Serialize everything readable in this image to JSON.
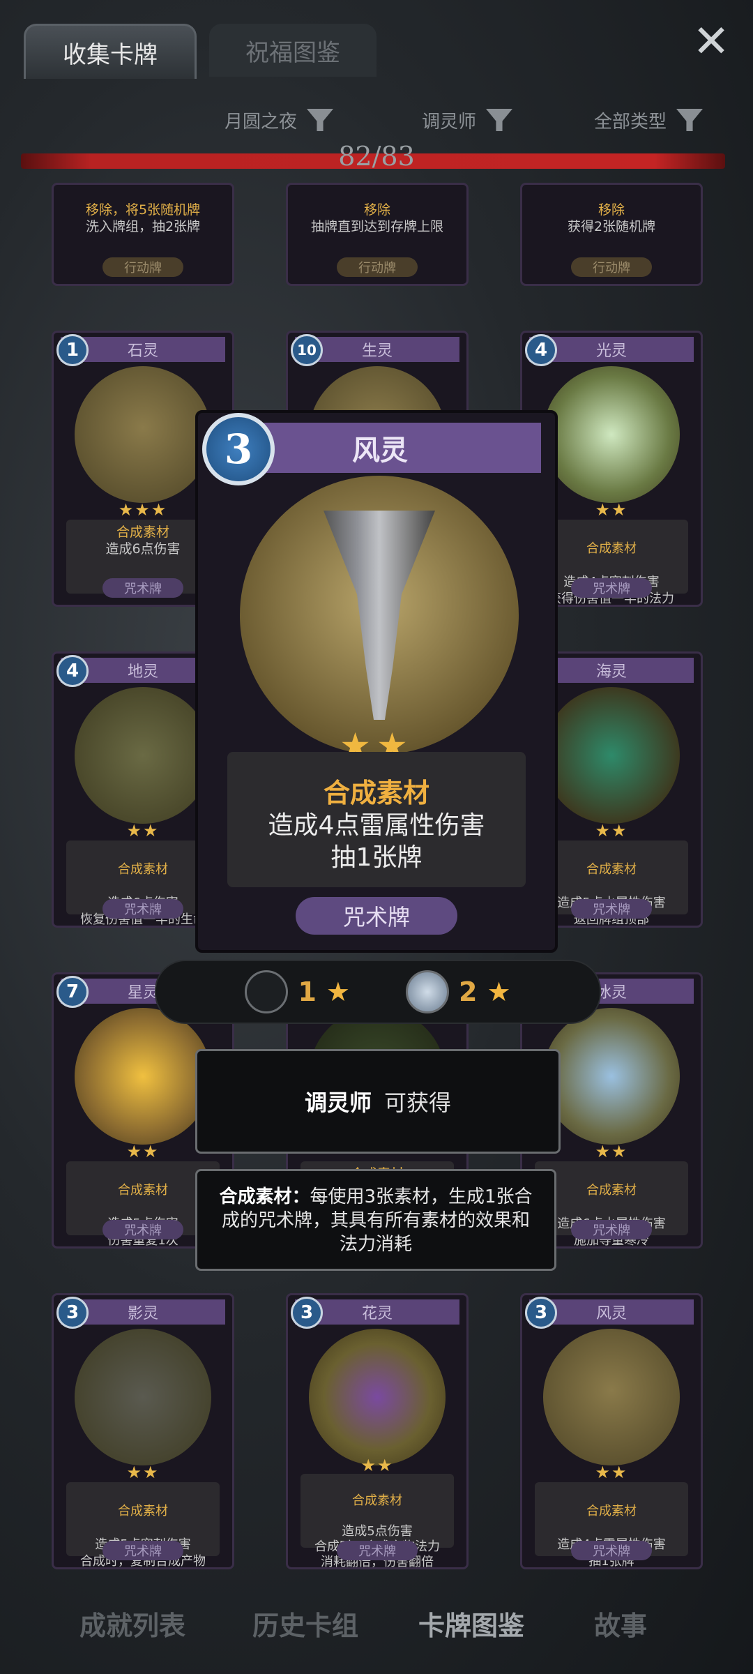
{
  "header": {
    "tabs": [
      {
        "label": "收集卡牌",
        "active": true
      },
      {
        "label": "祝福图鉴",
        "active": false
      }
    ],
    "close_icon": "close-x"
  },
  "filters": [
    {
      "label": "月圆之夜"
    },
    {
      "label": "调灵师"
    },
    {
      "label": "全部类型"
    }
  ],
  "progress": {
    "text": "82/83",
    "fraction": 0.988
  },
  "top_row": [
    {
      "lines": [
        "移除，将5张随机牌",
        "洗入牌组，抽2张牌"
      ],
      "type": "行动牌"
    },
    {
      "lines": [
        "移除",
        "抽牌直到达到存牌上限"
      ],
      "type": "行动牌"
    },
    {
      "lines": [
        "移除",
        "获得2张随机牌"
      ],
      "type": "行动牌"
    }
  ],
  "row2": [
    {
      "cost": "1",
      "name": "石灵",
      "stars": "★★★",
      "kw": "合成素材",
      "desc": "造成6点伤害",
      "type": "咒术牌"
    },
    {
      "cost": "10",
      "name": "生灵",
      "stars": "",
      "kw": "",
      "desc": "",
      "type": ""
    },
    {
      "cost": "4",
      "name": "光灵",
      "stars": "★★",
      "kw": "合成素材",
      "desc": "造成4点穿刺伤害\n获得伤害值一半的法力",
      "type": "咒术牌"
    }
  ],
  "row3": [
    {
      "cost": "4",
      "name": "地灵",
      "stars": "★★",
      "kw": "合成素材",
      "desc": "造成6点伤害\n恢复伤害值一半的生命",
      "type": "咒术牌"
    },
    {
      "cost": "",
      "name": "海灵",
      "stars": "★★",
      "kw": "合成素材",
      "desc": "造成5点水属性伤害\n返回牌组顶部",
      "type": "咒术牌"
    }
  ],
  "row4": [
    {
      "cost": "7",
      "name": "星灵",
      "stars": "★★",
      "kw": "合成素材",
      "desc": "造成5点伤害\n伤害重复1次",
      "type": "咒术牌"
    },
    {
      "cost": "",
      "name": "",
      "stars": "",
      "kw": "合成素材",
      "desc": "",
      "type": ""
    },
    {
      "cost": "4",
      "name": "冰灵",
      "stars": "★★",
      "kw": "合成素材",
      "desc": "造成6点水属性伤害\n施加等量寒冷",
      "type": "咒术牌"
    }
  ],
  "row5": [
    {
      "cost": "3",
      "name": "影灵",
      "stars": "★★",
      "kw": "合成素材",
      "desc": "造成5点穿刺伤害\n合成时，复制合成产物",
      "type": "咒术牌"
    },
    {
      "cost": "3",
      "name": "花灵",
      "stars": "★★",
      "kw": "合成素材",
      "desc": "造成5点伤害\n合成时，合成产物法力\n消耗翻倍，伤害翻倍",
      "type": "咒术牌"
    },
    {
      "cost": "3",
      "name": "风灵",
      "stars": "★★",
      "kw": "合成素材",
      "desc": "造成4点雷属性伤害\n抽1张牌",
      "type": "咒术牌"
    }
  ],
  "detail": {
    "cost": "3",
    "name": "风灵",
    "stars": "★★",
    "kw": "合成素材",
    "desc1": "造成4点雷属性伤害",
    "desc2": "抽1张牌",
    "type": "咒术牌"
  },
  "upgrade": [
    {
      "level": "1",
      "star": "★"
    },
    {
      "level": "2",
      "star": "★"
    }
  ],
  "obtain": {
    "who": "调灵师",
    "how": "可获得"
  },
  "explain": {
    "title": "合成素材：",
    "body": "每使用3张素材，生成1张合成的咒术牌，其具有所有素材的效果和法力消耗"
  },
  "nav": [
    {
      "label": "成就列表"
    },
    {
      "label": "历史卡组"
    },
    {
      "label": "卡牌图鉴",
      "selected": true
    },
    {
      "label": "故事"
    }
  ],
  "colors": {
    "accent_gold": "#e2b048",
    "card_purple": "#5a4478",
    "progress_red": "#c42424",
    "cost_blue": "#2a5a8a"
  }
}
